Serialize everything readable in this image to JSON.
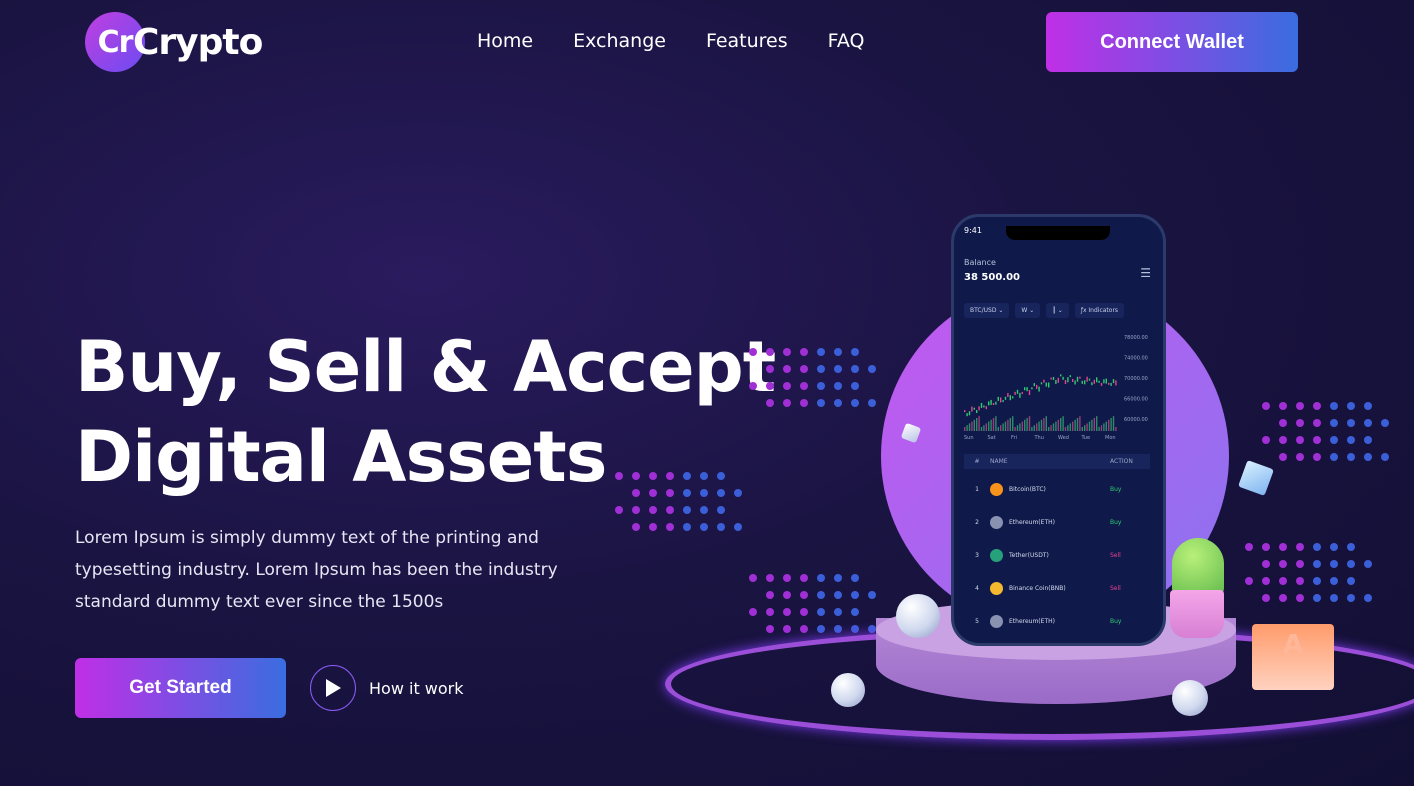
{
  "header": {
    "logo_badge": "Cr",
    "logo_text": "Crypto",
    "nav": [
      "Home",
      "Exchange",
      "Features",
      "FAQ"
    ],
    "connect_label": "Connect Wallet"
  },
  "hero": {
    "title_line1": "Buy, Sell & Accept",
    "title_line2": "Digital Assets",
    "description": "Lorem Ipsum is simply dummy text of the printing and typesetting industry. Lorem Ipsum has been the industry standard dummy text ever since the 1500s",
    "cta_label": "Get Started",
    "secondary_label": "How it work"
  },
  "phone": {
    "time": "9:41",
    "balance_label": "Balance",
    "balance_value": "38 500.00",
    "pair": "BTC/USD",
    "interval": "W",
    "indicators": "Indicators",
    "y_ticks": [
      "78000.00",
      "74000.00",
      "70000.00",
      "66000.00",
      "60000.00"
    ],
    "x_ticks": [
      "Sun",
      "Sat",
      "Fri",
      "Thu",
      "Wed",
      "Tue",
      "Mon"
    ],
    "table_head": {
      "num": "#",
      "name": "NAME",
      "action": "ACTION"
    },
    "rows": [
      {
        "num": "1",
        "name": "Bitcoin(BTC)",
        "action": "Buy",
        "color": "#f7931a"
      },
      {
        "num": "2",
        "name": "Ethereum(ETH)",
        "action": "Buy",
        "color": "#8a92b2"
      },
      {
        "num": "3",
        "name": "Tether(USDT)",
        "action": "Sell",
        "color": "#26a17b"
      },
      {
        "num": "4",
        "name": "Binance Coin(BNB)",
        "action": "Sell",
        "color": "#f3ba2f"
      },
      {
        "num": "5",
        "name": "Ethereum(ETH)",
        "action": "Buy",
        "color": "#8a92b2"
      }
    ]
  },
  "colors": {
    "accent_start": "#c02fe6",
    "accent_end": "#3a6de0",
    "buy": "#2ecc71",
    "sell": "#e84393"
  }
}
